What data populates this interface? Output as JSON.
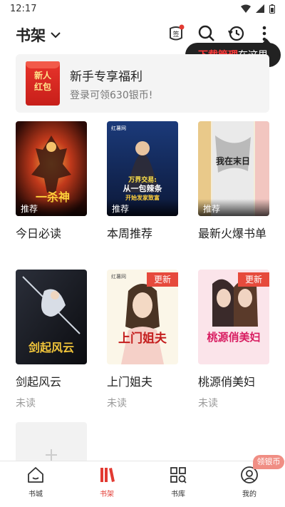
{
  "status_bar": {
    "time": "12:17"
  },
  "header": {
    "title": "书架"
  },
  "tooltip": {
    "highlight": "下载管理",
    "rest": "在这里"
  },
  "banner": {
    "icon_text_line1": "新人",
    "icon_text_line2": "红包",
    "title": "新手专享福利",
    "subtitle": "登录可领630银币!"
  },
  "books": [
    {
      "title": "今日必读",
      "badge": "推荐",
      "status": ""
    },
    {
      "title": "本周推荐",
      "badge": "推荐",
      "status": ""
    },
    {
      "title": "最新火爆书单",
      "badge": "推荐",
      "status": ""
    },
    {
      "title": "剑起风云",
      "badge": "",
      "status": "未读"
    },
    {
      "title": "上门姐夫",
      "badge": "更新",
      "status": "未读"
    },
    {
      "title": "桃源俏美妇",
      "badge": "更新",
      "status": "未读"
    }
  ],
  "cover_text": {
    "b1": "一杀神",
    "b2a": "万界交易:",
    "b2b": "从一包辣条",
    "b2c": "开始发家致富",
    "b3": "我在末日",
    "b4": "剑起风云",
    "b5": "上门姐夫",
    "b6": "桃源俏美妇",
    "brand": "红薯网"
  },
  "bottom_nav": [
    {
      "label": "书城",
      "icon": "home-icon"
    },
    {
      "label": "书架",
      "icon": "bookshelf-icon"
    },
    {
      "label": "书库",
      "icon": "library-icon"
    },
    {
      "label": "我的",
      "icon": "profile-icon"
    }
  ],
  "coin_badge": "领银币",
  "colors": {
    "accent": "#e23a32",
    "tooltip_bg": "#222222",
    "update_tag": "#e64a3c"
  }
}
